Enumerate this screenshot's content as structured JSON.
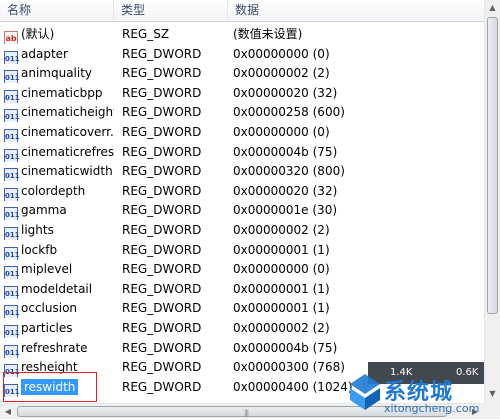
{
  "columns": {
    "name": "名称",
    "type": "类型",
    "data": "数据"
  },
  "entries": [
    {
      "name": "(默认)",
      "type": "REG_SZ",
      "data": "(数值未设置)",
      "icon": "string-value-icon"
    },
    {
      "name": "adapter",
      "type": "REG_DWORD",
      "data": "0x00000000 (0)",
      "icon": "dword-value-icon"
    },
    {
      "name": "animquality",
      "type": "REG_DWORD",
      "data": "0x00000002 (2)",
      "icon": "dword-value-icon"
    },
    {
      "name": "cinematicbpp",
      "type": "REG_DWORD",
      "data": "0x00000020 (32)",
      "icon": "dword-value-icon"
    },
    {
      "name": "cinematicheight",
      "type": "REG_DWORD",
      "data": "0x00000258 (600)",
      "icon": "dword-value-icon"
    },
    {
      "name": "cinematicoverr...",
      "type": "REG_DWORD",
      "data": "0x00000000 (0)",
      "icon": "dword-value-icon"
    },
    {
      "name": "cinematicrefresh",
      "type": "REG_DWORD",
      "data": "0x0000004b (75)",
      "icon": "dword-value-icon"
    },
    {
      "name": "cinematicwidth",
      "type": "REG_DWORD",
      "data": "0x00000320 (800)",
      "icon": "dword-value-icon"
    },
    {
      "name": "colordepth",
      "type": "REG_DWORD",
      "data": "0x00000020 (32)",
      "icon": "dword-value-icon"
    },
    {
      "name": "gamma",
      "type": "REG_DWORD",
      "data": "0x0000001e (30)",
      "icon": "dword-value-icon"
    },
    {
      "name": "lights",
      "type": "REG_DWORD",
      "data": "0x00000002 (2)",
      "icon": "dword-value-icon"
    },
    {
      "name": "lockfb",
      "type": "REG_DWORD",
      "data": "0x00000001 (1)",
      "icon": "dword-value-icon"
    },
    {
      "name": "miplevel",
      "type": "REG_DWORD",
      "data": "0x00000000 (0)",
      "icon": "dword-value-icon"
    },
    {
      "name": "modeldetail",
      "type": "REG_DWORD",
      "data": "0x00000001 (1)",
      "icon": "dword-value-icon"
    },
    {
      "name": "occlusion",
      "type": "REG_DWORD",
      "data": "0x00000001 (1)",
      "icon": "dword-value-icon"
    },
    {
      "name": "particles",
      "type": "REG_DWORD",
      "data": "0x00000002 (2)",
      "icon": "dword-value-icon"
    },
    {
      "name": "refreshrate",
      "type": "REG_DWORD",
      "data": "0x0000004b (75)",
      "icon": "dword-value-icon"
    },
    {
      "name": "resheight",
      "type": "REG_DWORD",
      "data": "0x00000300 (768)",
      "icon": "dword-value-icon"
    },
    {
      "name": "reswidth",
      "type": "REG_DWORD",
      "data": "0x00000400 (1024)",
      "icon": "dword-value-icon",
      "selected": true
    }
  ],
  "status_overlay": {
    "left": "1.4K",
    "right": "0.6K"
  },
  "watermark": {
    "brand": "系统城",
    "url": "xitongcheng.com"
  },
  "colors": {
    "selection": "#3399ff",
    "focus_box": "#e0201a",
    "dword_icon": "#3d63b8",
    "string_icon": "#c03020",
    "watermark": "#1f7ad6"
  }
}
